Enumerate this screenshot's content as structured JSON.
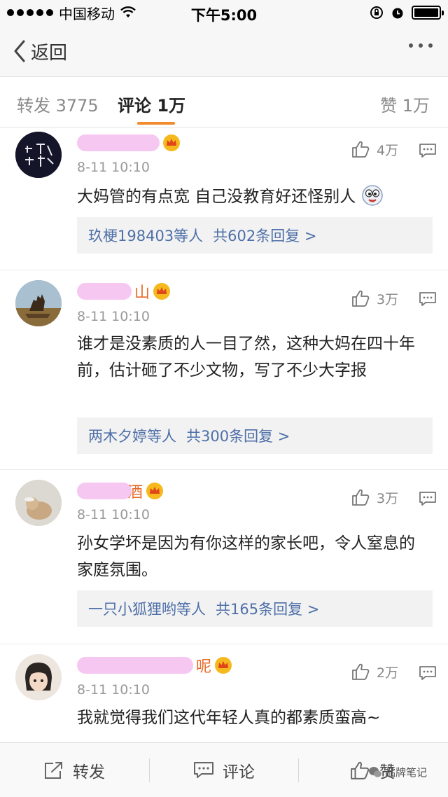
{
  "status_bar": {
    "carrier": "中国移动",
    "time": "下午5:00"
  },
  "nav": {
    "back_label": "返回"
  },
  "tabs": {
    "repost": "转发 3775",
    "comment": "评论 1万",
    "like": "赞 1万"
  },
  "comments": [
    {
      "name_visible": "",
      "time": "8-11 10:10",
      "likes": "4万",
      "text": "大妈管的有点宽 自己没教育好还怪别人",
      "reply_users": "玖梗198403等人",
      "reply_count": "共602条回复 >"
    },
    {
      "name_visible": "山",
      "time": "8-11 10:10",
      "likes": "3万",
      "text": "谁才是没素质的人一目了然，这种大妈在四十年前，估计砸了不少文物，写了不少大字报",
      "reply_users": "两木夕婷等人",
      "reply_count": "共300条回复 >"
    },
    {
      "name_visible": "酒",
      "time": "8-11 10:10",
      "likes": "3万",
      "text": "孙女学坏是因为有你这样的家长吧，令人窒息的家庭氛围。",
      "reply_users": "一只小狐狸哟等人",
      "reply_count": "共165条回复 >"
    },
    {
      "name_visible": "呢",
      "time": "8-11 10:10",
      "likes": "2万",
      "text": "我就觉得我们这代年轻人真的都素质蛮高~"
    }
  ],
  "bottom_bar": {
    "repost": "转发",
    "comment": "评论",
    "like": "赞"
  },
  "watermark": "品牌笔记",
  "colors": {
    "accent": "#f28a2e",
    "username": "#e86a2a",
    "link": "#4e6fa8"
  }
}
